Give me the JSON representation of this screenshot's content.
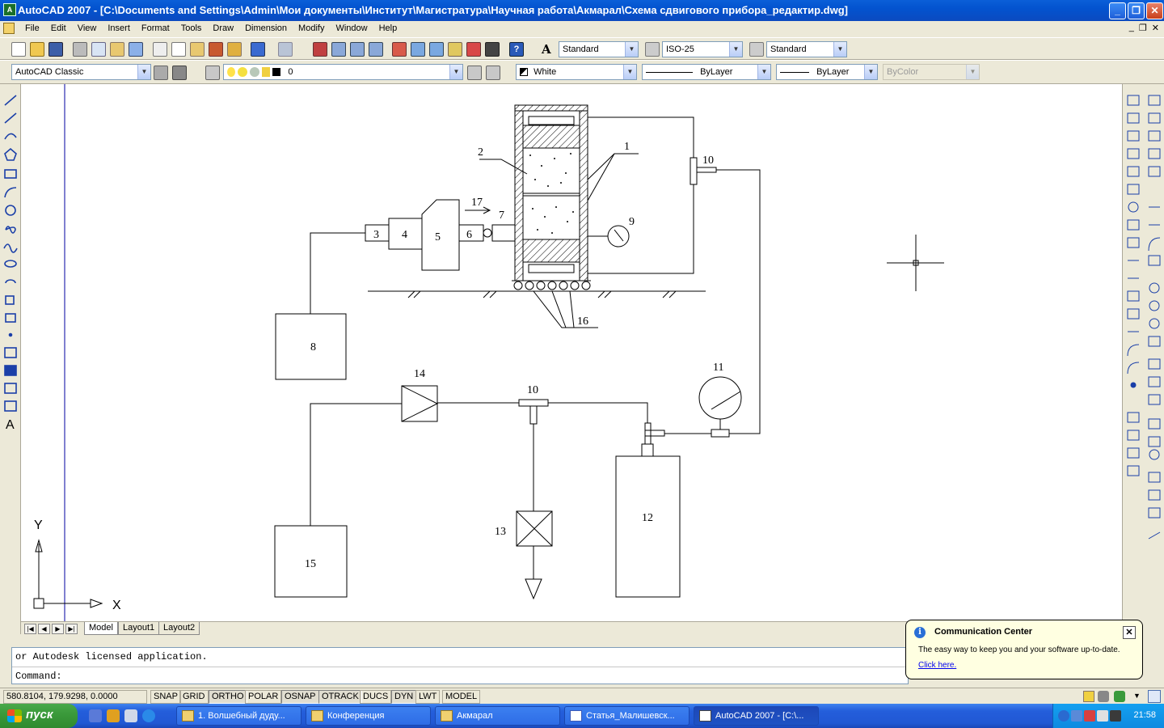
{
  "window": {
    "title": "AutoCAD 2007 - [C:\\Documents and Settings\\Admin\\Мои документы\\Институт\\Магистратура\\Научная работа\\Акмарал\\Схема сдвигового прибора_редактир.dwg]",
    "min": "_",
    "max": "❐",
    "close": "✕"
  },
  "menu": {
    "items": [
      "File",
      "Edit",
      "View",
      "Insert",
      "Format",
      "Tools",
      "Draw",
      "Dimension",
      "Modify",
      "Window",
      "Help"
    ],
    "mdi": [
      "_",
      "❐",
      "✕"
    ]
  },
  "toolbar1": {
    "text_style": "Standard",
    "dim_style": "ISO-25",
    "table_style": "Standard"
  },
  "toolbar2": {
    "workspace": "AutoCAD Classic",
    "layer": "0",
    "color": "White",
    "linetype": "ByLayer",
    "lineweight": "ByLayer",
    "plotstyle": "ByColor"
  },
  "drawing": {
    "labels": [
      "1",
      "2",
      "3",
      "4",
      "5",
      "6",
      "7",
      "8",
      "9",
      "10",
      "10",
      "11",
      "12",
      "13",
      "14",
      "15",
      "16",
      "17"
    ],
    "ucs_x": "X",
    "ucs_y": "Y"
  },
  "tabs": {
    "nav": [
      "|◀",
      "◀",
      "▶",
      "▶|"
    ],
    "items": [
      "Model",
      "Layout1",
      "Layout2"
    ]
  },
  "command": {
    "line1": "or Autodesk licensed application.",
    "line2": "Command:"
  },
  "status": {
    "coords": "580.8104, 179.9298, 0.0000",
    "buttons": [
      "SNAP",
      "GRID",
      "ORTHO",
      "POLAR",
      "OSNAP",
      "OTRACK",
      "DUCS",
      "DYN",
      "LWT",
      "MODEL"
    ]
  },
  "balloon": {
    "title": "Communication Center",
    "body": "The easy way to keep you and your software up-to-date.",
    "link": "Click here.",
    "close": "✕"
  },
  "taskbar": {
    "start": "пуск",
    "tasks": [
      "1. Волшебный дуду...",
      "Конференция",
      "Акмарал",
      "Статья_Малишевск...",
      "AutoCAD 2007 - [C:\\..."
    ],
    "clock": "21:58"
  }
}
